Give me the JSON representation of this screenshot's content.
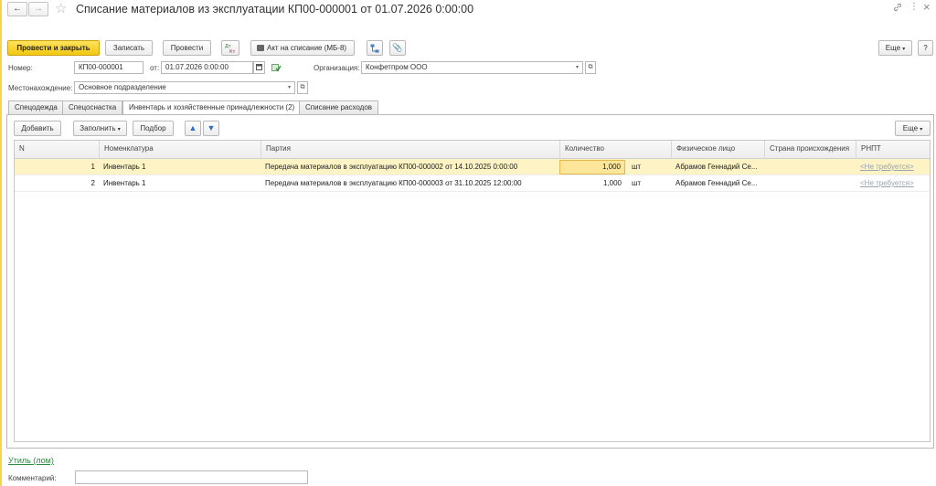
{
  "window": {
    "title": "Списание материалов из эксплуатации КП00-000001 от 01.07.2026 0:00:00",
    "top_icons": {
      "link": "link-icon",
      "more": "⋮",
      "close": "×"
    }
  },
  "toolbar": {
    "post_close": "Провести и закрыть",
    "save": "Записать",
    "post": "Провести",
    "dt_kt": "Дт Кт",
    "act": "Акт на списание (МБ-8)",
    "more": "Еще",
    "help": "?"
  },
  "header": {
    "number_label": "Номер:",
    "number_value": "КП00-000001",
    "date_label": "от:",
    "date_value": "01.07.2026  0:00:00",
    "org_label": "Организация:",
    "org_value": "Конфетпром ООО",
    "location_label": "Местонахождение:",
    "location_value": "Основное подразделение"
  },
  "tabs": [
    {
      "label": "Спецодежда"
    },
    {
      "label": "Спецоснастка"
    },
    {
      "label": "Инвентарь и хозяйственные принадлежности (2)"
    },
    {
      "label": "Списание расходов"
    }
  ],
  "table_toolbar": {
    "add": "Добавить",
    "fill": "Заполнить",
    "select": "Подбор",
    "more": "Еще"
  },
  "table": {
    "columns": [
      "N",
      "Номенклатура",
      "Партия",
      "Количество",
      "Физическое лицо",
      "Страна происхождения",
      "РНПТ"
    ],
    "rows": [
      {
        "n": "1",
        "item": "Инвентарь 1",
        "batch": "Передача материалов в эксплуатацию КП00-000002 от 14.10.2025 0:00:00",
        "qty": "1,000",
        "unit": "шт",
        "person": "Абрамов Геннадий Се...",
        "country": "",
        "rnpt": "<Не требуется>"
      },
      {
        "n": "2",
        "item": "Инвентарь 1",
        "batch": "Передача материалов в эксплуатацию КП00-000003 от 31.10.2025 12:00:00",
        "qty": "1,000",
        "unit": "шт",
        "person": "Абрамов Геннадий Се...",
        "country": "",
        "rnpt": "<Не требуется>"
      }
    ]
  },
  "footer": {
    "util_link": "Утиль (лом)",
    "comment_label": "Комментарий:",
    "comment_value": ""
  }
}
